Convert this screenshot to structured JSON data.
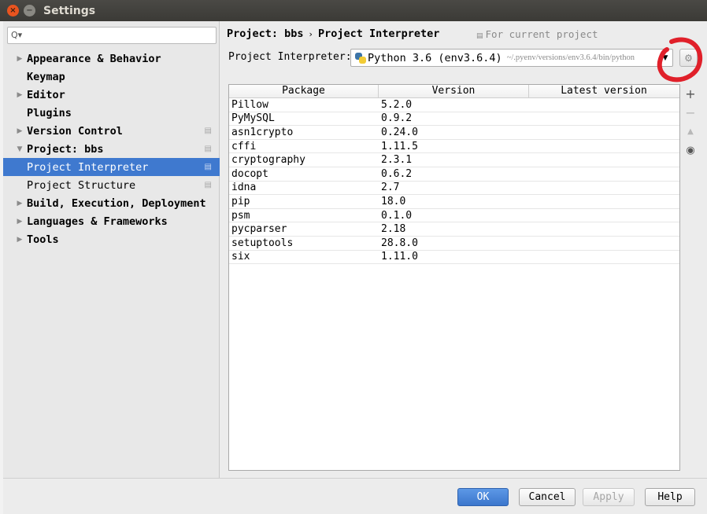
{
  "window": {
    "title": "Settings",
    "close_glyph": "×",
    "min_glyph": "−"
  },
  "search": {
    "value": "",
    "placeholder": "",
    "icon": "search-icon"
  },
  "sidebar": {
    "items": [
      {
        "label": "Appearance & Behavior",
        "expandable": true,
        "expanded": false
      },
      {
        "label": "Keymap",
        "expandable": false
      },
      {
        "label": "Editor",
        "expandable": true,
        "expanded": false
      },
      {
        "label": "Plugins",
        "expandable": false
      },
      {
        "label": "Version Control",
        "expandable": true,
        "expanded": false,
        "project_level": true
      },
      {
        "label": "Project: bbs",
        "expandable": true,
        "expanded": true,
        "project_level": true
      },
      {
        "label": "Project Interpreter",
        "child": true,
        "selected": true,
        "project_level": true
      },
      {
        "label": "Project Structure",
        "child": true,
        "project_level": true
      },
      {
        "label": "Build, Execution, Deployment",
        "expandable": true,
        "expanded": false
      },
      {
        "label": "Languages & Frameworks",
        "expandable": true,
        "expanded": false
      },
      {
        "label": "Tools",
        "expandable": true,
        "expanded": false
      }
    ]
  },
  "breadcrumb": {
    "parent": "Project: bbs",
    "current": "Project Interpreter",
    "note": "For current project"
  },
  "interpreter": {
    "label": "Project Interpreter:",
    "name": "Python 3.6 (env3.6.4)",
    "path": "~/.pyenv/versions/env3.6.4/bin/python"
  },
  "packages": {
    "columns": [
      "Package",
      "Version",
      "Latest version"
    ],
    "rows": [
      {
        "package": "Pillow",
        "version": "5.2.0",
        "latest": ""
      },
      {
        "package": "PyMySQL",
        "version": "0.9.2",
        "latest": ""
      },
      {
        "package": "asn1crypto",
        "version": "0.24.0",
        "latest": ""
      },
      {
        "package": "cffi",
        "version": "1.11.5",
        "latest": ""
      },
      {
        "package": "cryptography",
        "version": "2.3.1",
        "latest": ""
      },
      {
        "package": "docopt",
        "version": "0.6.2",
        "latest": ""
      },
      {
        "package": "idna",
        "version": "2.7",
        "latest": ""
      },
      {
        "package": "pip",
        "version": "18.0",
        "latest": ""
      },
      {
        "package": "psm",
        "version": "0.1.0",
        "latest": ""
      },
      {
        "package": "pycparser",
        "version": "2.18",
        "latest": ""
      },
      {
        "package": "setuptools",
        "version": "28.8.0",
        "latest": ""
      },
      {
        "package": "six",
        "version": "1.11.0",
        "latest": ""
      }
    ]
  },
  "tools": {
    "add": "+",
    "remove": "−",
    "upgrade": "▲",
    "eye": "◉"
  },
  "footer": {
    "ok": "OK",
    "cancel": "Cancel",
    "apply": "Apply",
    "help": "Help"
  },
  "colors": {
    "selection": "#3f79cf",
    "ok_button": "#3b76cc",
    "annotation": "#e0202a"
  }
}
